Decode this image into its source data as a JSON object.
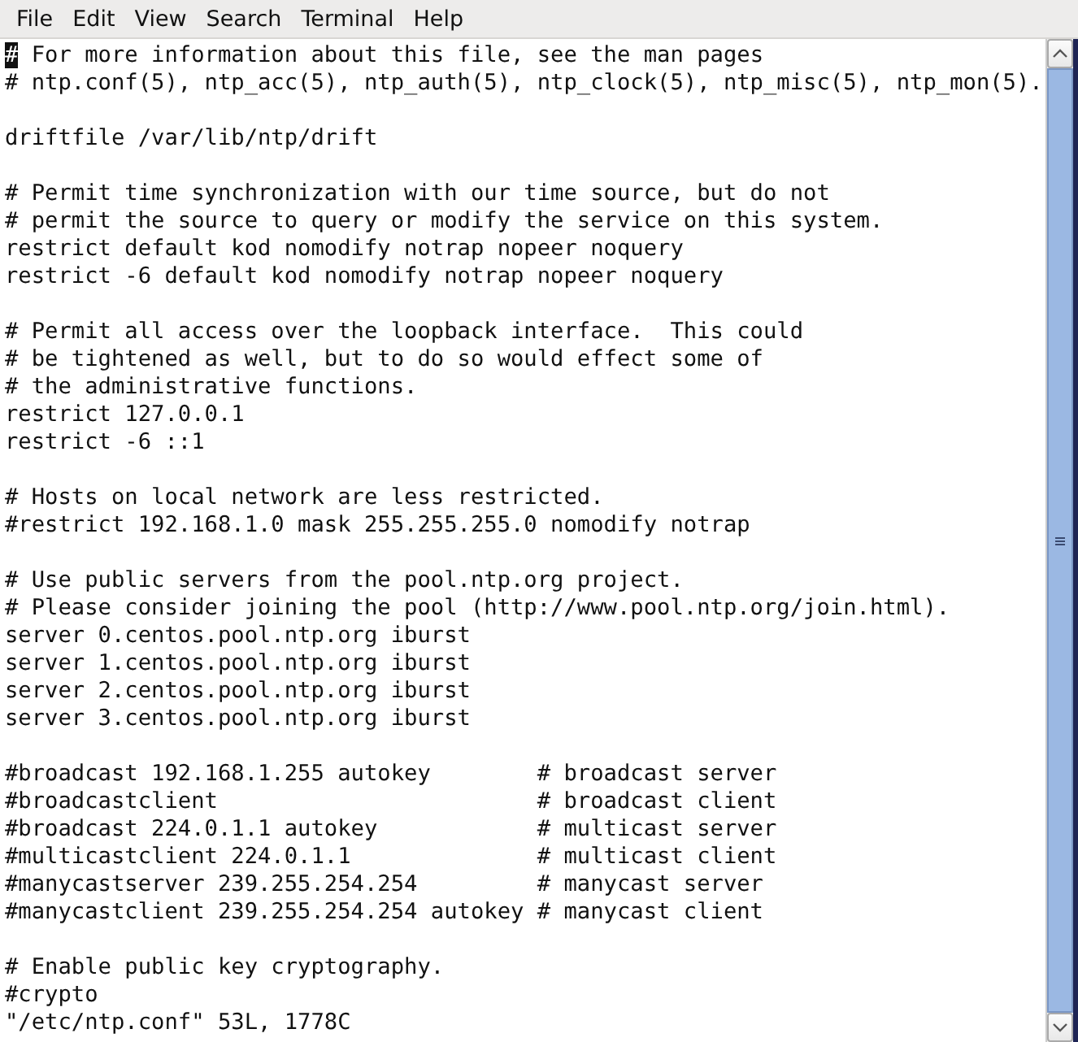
{
  "menu": [
    "File",
    "Edit",
    "View",
    "Search",
    "Terminal",
    "Help"
  ],
  "cursor_char": "#",
  "blocks": [
    [
      " For more information about this file, see the man pages",
      "# ntp.conf(5), ntp_acc(5), ntp_auth(5), ntp_clock(5), ntp_misc(5), ntp_mon(5)."
    ],
    [
      "driftfile /var/lib/ntp/drift"
    ],
    [
      "# Permit time synchronization with our time source, but do not",
      "# permit the source to query or modify the service on this system.",
      "restrict default kod nomodify notrap nopeer noquery",
      "restrict -6 default kod nomodify notrap nopeer noquery"
    ],
    [
      "# Permit all access over the loopback interface.  This could",
      "# be tightened as well, but to do so would effect some of",
      "# the administrative functions.",
      "restrict 127.0.0.1",
      "restrict -6 ::1"
    ],
    [
      "# Hosts on local network are less restricted.",
      "#restrict 192.168.1.0 mask 255.255.255.0 nomodify notrap"
    ],
    [
      "# Use public servers from the pool.ntp.org project.",
      "# Please consider joining the pool (http://www.pool.ntp.org/join.html).",
      "server 0.centos.pool.ntp.org iburst",
      "server 1.centos.pool.ntp.org iburst",
      "server 2.centos.pool.ntp.org iburst",
      "server 3.centos.pool.ntp.org iburst"
    ],
    [
      "#broadcast 192.168.1.255 autokey        # broadcast server",
      "#broadcastclient                        # broadcast client",
      "#broadcast 224.0.1.1 autokey            # multicast server",
      "#multicastclient 224.0.1.1              # multicast client",
      "#manycastserver 239.255.254.254         # manycast server",
      "#manycastclient 239.255.254.254 autokey # manycast client"
    ],
    [
      "# Enable public key cryptography.",
      "#crypto"
    ]
  ],
  "status": "\"/etc/ntp.conf\" 53L, 1778C"
}
